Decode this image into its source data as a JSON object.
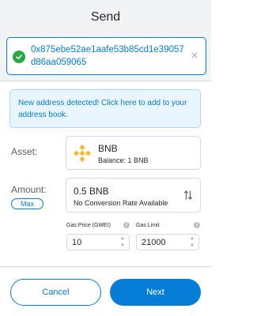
{
  "header": {
    "title": "Send"
  },
  "recipient": {
    "address": "0x875ebe52ae1aafe53b85cd1e39057d86aa059065",
    "clear_icon": "close-icon",
    "status_icon": "check-circle-icon"
  },
  "alert": {
    "text": "New address detected! Click here to add to your address book."
  },
  "asset": {
    "label": "Asset:",
    "name": "BNB",
    "balance": "Balance: 1 BNB"
  },
  "amount": {
    "label": "Amount:",
    "max_label": "Max",
    "value": "0.5  BNB",
    "conversion": "No Conversion Rate Available"
  },
  "gas": {
    "price_label": "Gas Price (GWEI)",
    "price_value": "10",
    "limit_label": "Gas Limit",
    "limit_value": "21000"
  },
  "footer": {
    "cancel_label": "Cancel",
    "next_label": "Next"
  },
  "colors": {
    "primary": "#037dd6",
    "success": "#28a745",
    "bnb": "#f3ba2f"
  }
}
